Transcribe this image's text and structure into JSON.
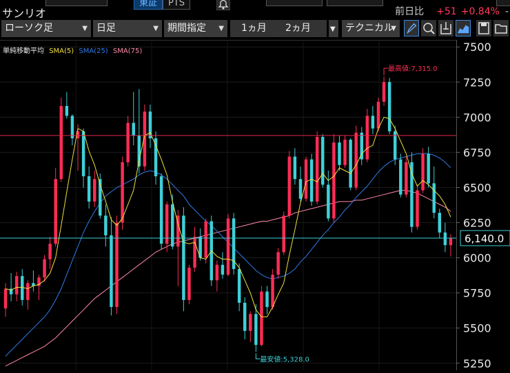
{
  "header": {
    "title": "サンリオ",
    "exchange_tabs": [
      "東証",
      "PTS"
    ],
    "change_label": "前日比",
    "change_value": "+51",
    "change_pct": "+0.84%",
    "change_more": "-"
  },
  "toolbar": {
    "chart_type": "ローソク足",
    "interval": "日足",
    "period_label": "期間指定",
    "range_1": "1ヵ月",
    "range_2": "2ヵ月",
    "technical_label": "テクニカル",
    "icons": [
      "pencil-icon",
      "zoom-icon",
      "export-icon",
      "area-chart-icon",
      "save-icon",
      "folder-icon"
    ]
  },
  "legend": {
    "title": "単純移動平均",
    "sma5": "SMA(5)",
    "sma25": "SMA(25)",
    "sma75": "SMA(75)"
  },
  "colors": {
    "up": "#ff2d55",
    "down": "#3fd0d8",
    "sma5": "#f0e040",
    "sma25": "#2f7be8",
    "sma75": "#ff8aa8",
    "red_line": "#e0264c",
    "price_line": "#3fd0d8"
  },
  "chart_data": {
    "type": "candlestick",
    "ylim": [
      5200,
      7550
    ],
    "y_ticks": [
      5250,
      5500,
      5750,
      6000,
      6250,
      6500,
      6750,
      7000,
      7250,
      7500
    ],
    "y_tick_labels": [
      "5250",
      "5500",
      "5750",
      "6000",
      "6250",
      "6500",
      "6750",
      "7000",
      "7250",
      "7500"
    ],
    "current_price": 6140,
    "current_price_label": "6,140.0",
    "high_label": "最高値:7,315.0",
    "high_value": 7315,
    "low_label": "最安値:5,328.0",
    "low_value": 5328,
    "horizontal_line": 6870,
    "candles": [
      [
        5640,
        5820,
        5580,
        5780
      ],
      [
        5780,
        5890,
        5690,
        5740
      ],
      [
        5740,
        5900,
        5690,
        5870
      ],
      [
        5870,
        5920,
        5660,
        5700
      ],
      [
        5700,
        5840,
        5630,
        5820
      ],
      [
        5820,
        5910,
        5760,
        5800
      ],
      [
        5800,
        5880,
        5700,
        5860
      ],
      [
        5860,
        6020,
        5830,
        5990
      ],
      [
        5990,
        6150,
        5920,
        6100
      ],
      [
        6100,
        6640,
        6080,
        6560
      ],
      [
        6560,
        7140,
        6540,
        7080
      ],
      [
        7080,
        7180,
        6990,
        7010
      ],
      [
        7010,
        7020,
        6800,
        6850
      ],
      [
        6850,
        6950,
        6620,
        6900
      ],
      [
        6900,
        6920,
        6500,
        6580
      ],
      [
        6580,
        6650,
        6350,
        6400
      ],
      [
        6400,
        6620,
        6360,
        6560
      ],
      [
        6560,
        6600,
        6280,
        6300
      ],
      [
        6300,
        6380,
        6080,
        6160
      ],
      [
        6160,
        6290,
        5590,
        5650
      ],
      [
        5650,
        6300,
        5600,
        6250
      ],
      [
        6250,
        6720,
        6200,
        6680
      ],
      [
        6680,
        7010,
        6650,
        6960
      ],
      [
        6960,
        7180,
        6800,
        6870
      ],
      [
        6870,
        7200,
        6600,
        6650
      ],
      [
        6650,
        7090,
        6620,
        7040
      ],
      [
        7040,
        7090,
        6780,
        6850
      ],
      [
        6850,
        6900,
        6520,
        6580
      ],
      [
        6580,
        6600,
        6060,
        6100
      ],
      [
        6100,
        6400,
        6040,
        6380
      ],
      [
        6380,
        6450,
        6060,
        6080
      ],
      [
        6080,
        6340,
        5800,
        6300
      ],
      [
        6300,
        6360,
        5620,
        5700
      ],
      [
        5700,
        5950,
        5670,
        5930
      ],
      [
        5930,
        6220,
        5900,
        6150
      ],
      [
        6150,
        6210,
        5980,
        6000
      ],
      [
        6000,
        6280,
        5960,
        6260
      ],
      [
        6260,
        6300,
        5800,
        5840
      ],
      [
        5840,
        5980,
        5760,
        5950
      ],
      [
        5950,
        6040,
        5850,
        5880
      ],
      [
        5880,
        6310,
        5870,
        6280
      ],
      [
        6280,
        6320,
        5880,
        5920
      ],
      [
        5920,
        5960,
        5620,
        5680
      ],
      [
        5680,
        5720,
        5420,
        5480
      ],
      [
        5480,
        5620,
        5400,
        5600
      ],
      [
        5600,
        5670,
        5330,
        5380
      ],
      [
        5380,
        5800,
        5370,
        5760
      ],
      [
        5760,
        5800,
        5600,
        5650
      ],
      [
        5650,
        5920,
        5630,
        5880
      ],
      [
        5880,
        6070,
        5850,
        6040
      ],
      [
        6040,
        6330,
        6020,
        6300
      ],
      [
        6300,
        6760,
        6280,
        6720
      ],
      [
        6720,
        6780,
        6520,
        6560
      ],
      [
        6560,
        6650,
        6400,
        6420
      ],
      [
        6420,
        6720,
        6400,
        6700
      ],
      [
        6700,
        6740,
        6370,
        6400
      ],
      [
        6400,
        6900,
        6380,
        6860
      ],
      [
        6860,
        6880,
        6500,
        6520
      ],
      [
        6520,
        6620,
        6260,
        6280
      ],
      [
        6280,
        6880,
        6250,
        6820
      ],
      [
        6820,
        6870,
        6620,
        6660
      ],
      [
        6660,
        6870,
        6640,
        6840
      ],
      [
        6840,
        6850,
        6480,
        6500
      ],
      [
        6500,
        6940,
        6480,
        6890
      ],
      [
        6890,
        6930,
        6660,
        6700
      ],
      [
        6700,
        7060,
        6680,
        7010
      ],
      [
        7010,
        7080,
        6880,
        6920
      ],
      [
        6920,
        7140,
        6900,
        7110
      ],
      [
        7110,
        7290,
        7080,
        7250
      ],
      [
        7250,
        7280,
        6880,
        6900
      ],
      [
        6900,
        6940,
        6660,
        6700
      ],
      [
        6700,
        6740,
        6430,
        6450
      ],
      [
        6450,
        6720,
        6430,
        6680
      ],
      [
        6680,
        6750,
        6180,
        6220
      ],
      [
        6220,
        6520,
        6200,
        6480
      ],
      [
        6480,
        6780,
        6460,
        6740
      ],
      [
        6740,
        6790,
        6500,
        6530
      ],
      [
        6530,
        6650,
        6280,
        6320
      ],
      [
        6320,
        6350,
        6140,
        6180
      ],
      [
        6180,
        6250,
        6040,
        6090
      ],
      [
        6090,
        6170,
        6010,
        6140
      ]
    ],
    "sma5": [
      5780,
      5770,
      5790,
      5790,
      5780,
      5800,
      5810,
      5840,
      5890,
      6000,
      6230,
      6470,
      6700,
      6920,
      6900,
      6760,
      6660,
      6520,
      6400,
      6270,
      6230,
      6280,
      6380,
      6480,
      6690,
      6870,
      6890,
      6800,
      6700,
      6590,
      6400,
      6240,
      6110,
      6100,
      6110,
      6000,
      5990,
      6050,
      6010,
      5990,
      5990,
      5980,
      5930,
      5840,
      5750,
      5630,
      5580,
      5580,
      5650,
      5740,
      5820,
      6020,
      6200,
      6390,
      6540,
      6560,
      6540,
      6600,
      6550,
      6580,
      6640,
      6620,
      6600,
      6660,
      6740,
      6780,
      6800,
      6920,
      7000,
      6990,
      6920,
      6830,
      6740,
      6600,
      6510,
      6550,
      6520,
      6480,
      6440,
      6380,
      6290
    ],
    "sma25": [
      5300,
      5340,
      5380,
      5420,
      5460,
      5500,
      5540,
      5580,
      5630,
      5700,
      5780,
      5880,
      5980,
      6080,
      6180,
      6260,
      6330,
      6390,
      6440,
      6470,
      6500,
      6520,
      6540,
      6560,
      6590,
      6610,
      6620,
      6610,
      6590,
      6560,
      6520,
      6480,
      6440,
      6380,
      6340,
      6300,
      6260,
      6230,
      6190,
      6150,
      6110,
      6070,
      6030,
      5990,
      5950,
      5910,
      5880,
      5860,
      5850,
      5860,
      5870,
      5890,
      5920,
      5970,
      6010,
      6060,
      6110,
      6160,
      6200,
      6250,
      6290,
      6340,
      6380,
      6430,
      6470,
      6510,
      6560,
      6610,
      6650,
      6680,
      6700,
      6710,
      6720,
      6730,
      6740,
      6740,
      6740,
      6730,
      6710,
      6680,
      6640
    ],
    "sma75": [
      5230,
      5250,
      5270,
      5290,
      5310,
      5330,
      5350,
      5370,
      5400,
      5430,
      5470,
      5510,
      5550,
      5590,
      5630,
      5670,
      5710,
      5740,
      5770,
      5800,
      5830,
      5860,
      5890,
      5920,
      5950,
      5980,
      6010,
      6040,
      6060,
      6080,
      6100,
      6110,
      6120,
      6130,
      6140,
      6150,
      6160,
      6170,
      6180,
      6190,
      6200,
      6210,
      6220,
      6230,
      6240,
      6250,
      6260,
      6260,
      6270,
      6280,
      6290,
      6300,
      6320,
      6330,
      6340,
      6350,
      6360,
      6370,
      6380,
      6390,
      6400,
      6400,
      6400,
      6410,
      6410,
      6420,
      6430,
      6440,
      6450,
      6460,
      6470,
      6480,
      6480,
      6470,
      6460,
      6440,
      6420,
      6400,
      6380,
      6360,
      6330
    ]
  }
}
